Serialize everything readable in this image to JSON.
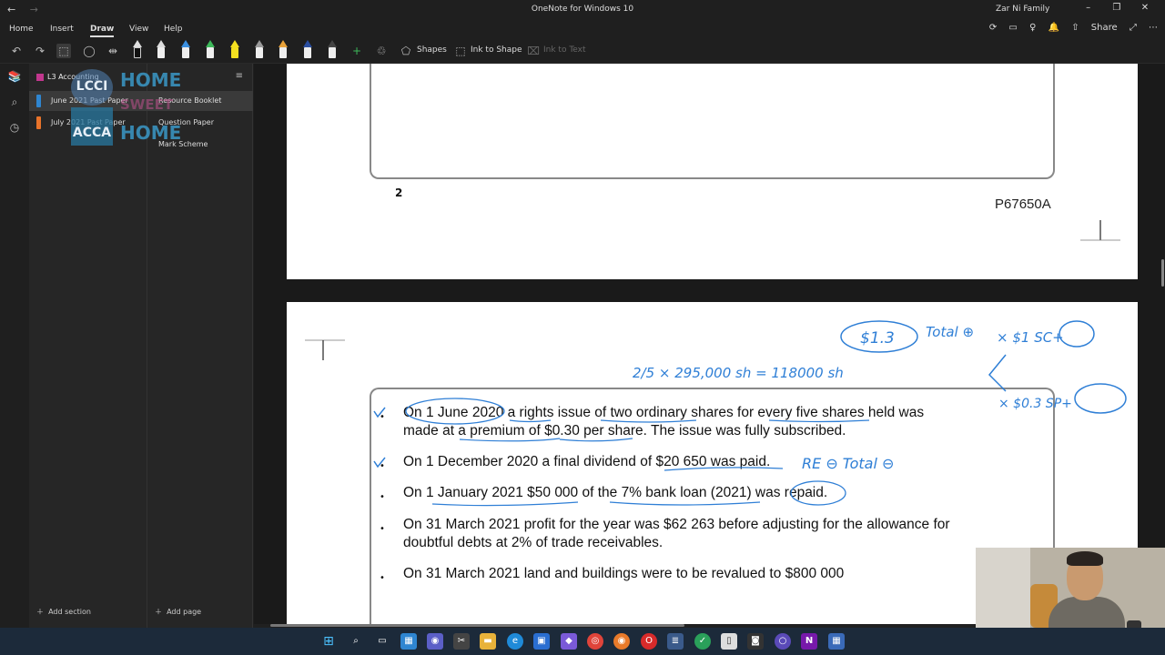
{
  "titlebar": {
    "title": "OneNote for Windows 10",
    "user": "Zar Ni Family",
    "back_icon": "back-arrow-icon",
    "forward_icon": "forward-arrow-icon"
  },
  "menu": {
    "items": [
      "Home",
      "Insert",
      "Draw",
      "View",
      "Help"
    ],
    "active": "Draw",
    "share_label": "Share"
  },
  "toolbar": {
    "shapes_label": "Shapes",
    "ink_to_shape_label": "Ink to Shape",
    "ink_to_text_label": "Ink to Text"
  },
  "notebook": {
    "name": "L3 Accounting",
    "sections": [
      {
        "label": "June 2021 Past Paper",
        "color": "#2f86d1",
        "selected": true
      },
      {
        "label": "July 2021 Past Paper",
        "color": "#e8732a",
        "selected": false
      }
    ],
    "add_section_label": "Add section"
  },
  "pages": {
    "items": [
      "Resource Booklet",
      "Question Paper",
      "Mark Scheme"
    ],
    "selected_index": 0,
    "add_page_label": "Add page"
  },
  "watermark": {
    "lcci": "LCCI",
    "acca": "ACCA",
    "home": "HOME",
    "sweet": "SWEET"
  },
  "document": {
    "page_number": "2",
    "paper_code": "P67650A",
    "bullets": [
      "On 1 June 2020 a rights issue of two ordinary shares for every five shares held was made at a premium of $0.30 per share. The issue was fully subscribed.",
      "On 1 December 2020 a final dividend of $20 650 was paid.",
      "On 1 January 2021 $50 000 of the 7% bank loan (2021) was repaid.",
      "On 31 March 2021 profit for the year was $62 263 before adjusting for the allowance for doubtful debts at 2% of trade receivables.",
      "On 31 March 2021 land and buildings were to be revalued to $800 000"
    ],
    "annotations": {
      "price": "$1.3",
      "total_plus": "Total ⊕",
      "sc": "× $1  SC+",
      "calc": "2/5 × 295,000 sh = 118000 sh",
      "sp": "× $0.3  SP+",
      "re_total": "RE ⊖   Total ⊖"
    }
  },
  "colors": {
    "ink": "#2f7fd6",
    "onenote_purple": "#7719aa",
    "notebook_pink": "#c2378e"
  }
}
